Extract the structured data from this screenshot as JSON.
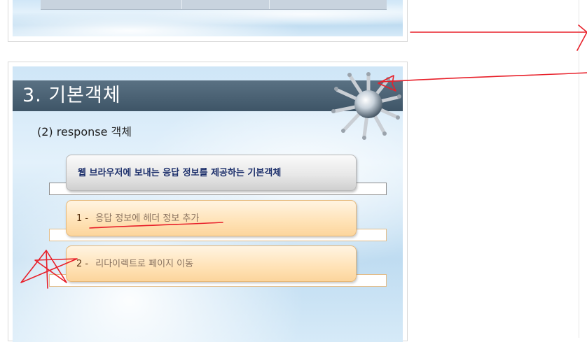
{
  "slide_top": {
    "table_visible": true
  },
  "slide": {
    "title": "3. 기본객체",
    "subtitle": "(2) response 객체",
    "description_box": "웹 브라우저에 보내는 응답 정보를 제공하는 기본객체",
    "items": [
      {
        "number": "1 -",
        "text": "응답 정보에 헤더 정보 추가"
      },
      {
        "number": "2 -",
        "text": "리다이렉트로 페이지 이동"
      }
    ]
  },
  "colors": {
    "title_bar": "#4a6376",
    "annotation": "#e8202a",
    "orange_box": "#ffe2b6",
    "gray_box": "#e0e0e0"
  },
  "icons": {
    "globe": "people-around-globe-icon"
  }
}
